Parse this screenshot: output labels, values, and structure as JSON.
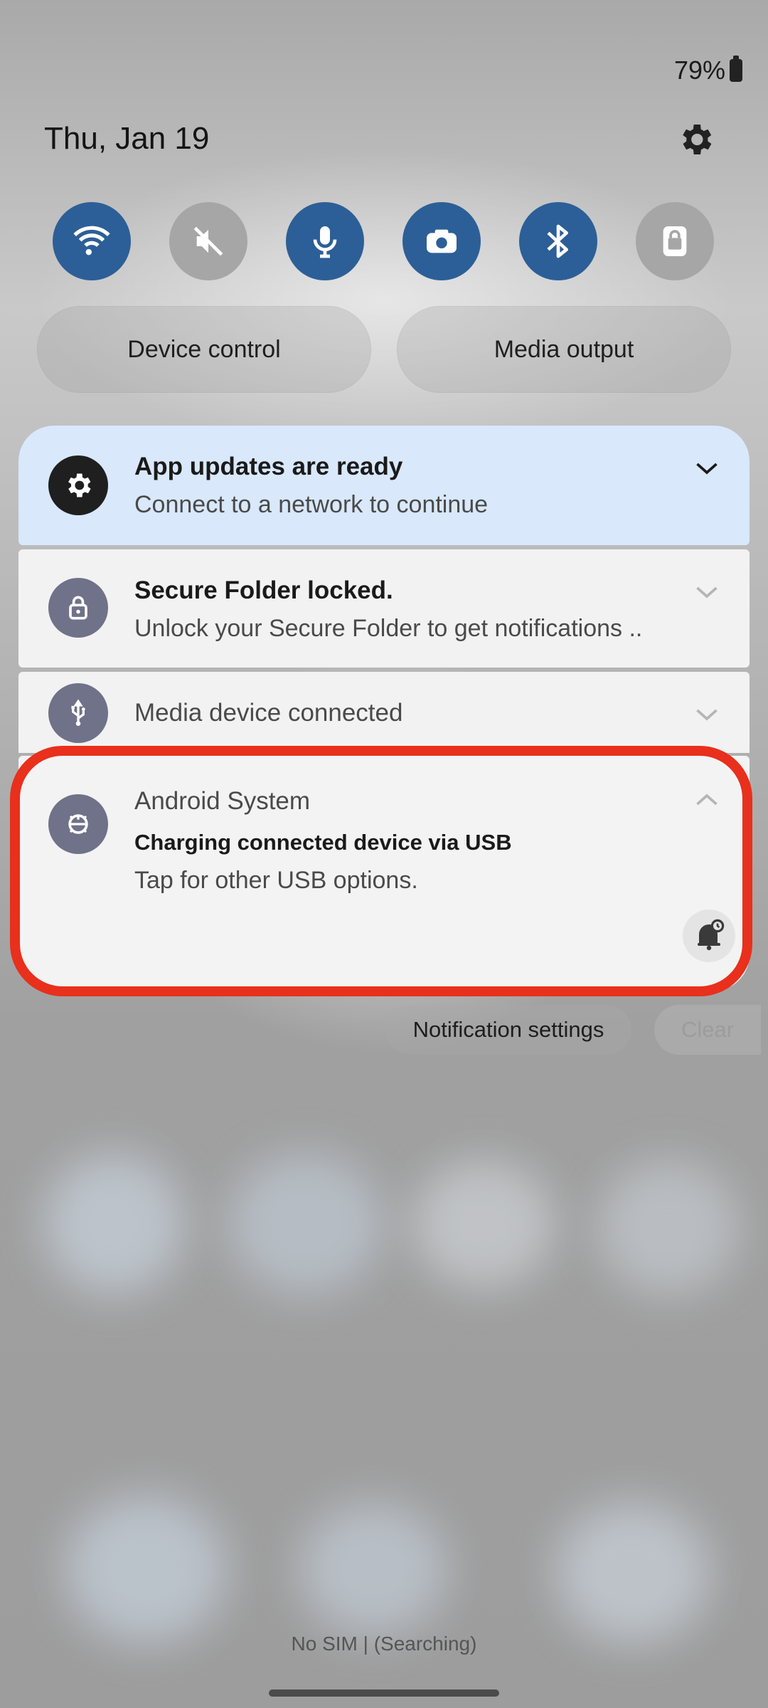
{
  "status_bar": {
    "battery_text": "79%"
  },
  "header": {
    "date": "Thu, Jan 19"
  },
  "quick_toggles": [
    {
      "name": "wifi",
      "state": "on"
    },
    {
      "name": "sound-muted",
      "state": "off"
    },
    {
      "name": "microphone",
      "state": "on"
    },
    {
      "name": "camera",
      "state": "on"
    },
    {
      "name": "bluetooth",
      "state": "on"
    },
    {
      "name": "lock",
      "state": "off"
    }
  ],
  "buttons": {
    "device_control": "Device control",
    "media_output": "Media output"
  },
  "notifications": [
    {
      "title": "App updates are ready",
      "subtitle": "Connect to a network to continue",
      "icon": "gear-icon"
    },
    {
      "title": "Secure Folder locked.",
      "subtitle": "Unlock your Secure Folder to get notifications ..",
      "icon": "lock-icon"
    },
    {
      "title": "Media device connected",
      "icon": "usb-icon"
    },
    {
      "app": "Android System",
      "title": "Charging connected device via USB",
      "subtitle": "Tap for other USB options.",
      "icon": "android-system-icon"
    }
  ],
  "footer_actions": {
    "notification_settings": "Notification settings",
    "clear": "Clear"
  },
  "carrier": {
    "text": "No SIM | (Searching)"
  },
  "colors": {
    "toggle_on": "#2c5f97",
    "highlight": "#e8301c",
    "card_highlighted_bg": "#d9e8fb"
  }
}
